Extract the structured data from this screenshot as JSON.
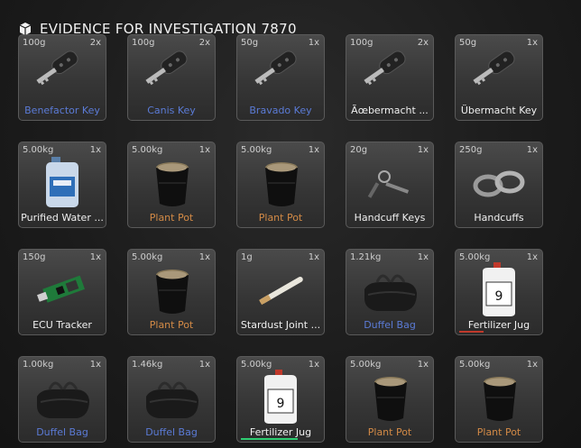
{
  "header": {
    "title": "EVIDENCE FOR INVESTIGATION 7870",
    "icon": "box-icon"
  },
  "slots": [
    {
      "weight": "100g",
      "qty": "2x",
      "name": "Benefactor Key",
      "rarity": "blue",
      "art": "key"
    },
    {
      "weight": "100g",
      "qty": "2x",
      "name": "Canis Key",
      "rarity": "blue",
      "art": "key"
    },
    {
      "weight": "50g",
      "qty": "1x",
      "name": "Bravado Key",
      "rarity": "blue",
      "art": "key"
    },
    {
      "weight": "100g",
      "qty": "2x",
      "name": "Ãœbermacht ...",
      "rarity": "white",
      "art": "key"
    },
    {
      "weight": "50g",
      "qty": "1x",
      "name": "Übermacht Key",
      "rarity": "white",
      "art": "key"
    },
    {
      "weight": "5.00kg",
      "qty": "1x",
      "name": "Purified Water ...",
      "rarity": "white",
      "art": "water"
    },
    {
      "weight": "5.00kg",
      "qty": "1x",
      "name": "Plant Pot",
      "rarity": "orange",
      "art": "pot"
    },
    {
      "weight": "5.00kg",
      "qty": "1x",
      "name": "Plant Pot",
      "rarity": "orange",
      "art": "pot"
    },
    {
      "weight": "20g",
      "qty": "1x",
      "name": "Handcuff Keys",
      "rarity": "white",
      "art": "cuffkeys"
    },
    {
      "weight": "250g",
      "qty": "1x",
      "name": "Handcuffs",
      "rarity": "white",
      "art": "cuffs"
    },
    {
      "weight": "150g",
      "qty": "1x",
      "name": "ECU Tracker",
      "rarity": "white",
      "art": "ecu"
    },
    {
      "weight": "5.00kg",
      "qty": "1x",
      "name": "Plant Pot",
      "rarity": "orange",
      "art": "pot"
    },
    {
      "weight": "1g",
      "qty": "1x",
      "name": "Stardust Joint ...",
      "rarity": "white",
      "art": "joint"
    },
    {
      "weight": "1.21kg",
      "qty": "1x",
      "name": "Duffel Bag",
      "rarity": "blue",
      "art": "bag"
    },
    {
      "weight": "5.00kg",
      "qty": "1x",
      "name": "Fertilizer Jug",
      "rarity": "white",
      "art": "jug",
      "bar": 0.3
    },
    {
      "weight": "1.00kg",
      "qty": "1x",
      "name": "Duffel Bag",
      "rarity": "blue",
      "art": "bag"
    },
    {
      "weight": "1.46kg",
      "qty": "1x",
      "name": "Duffel Bag",
      "rarity": "blue",
      "art": "bag"
    },
    {
      "weight": "5.00kg",
      "qty": "1x",
      "name": "Fertilizer Jug",
      "rarity": "white",
      "art": "jug",
      "bar": 0.7,
      "barColor": "#2ecc71"
    },
    {
      "weight": "5.00kg",
      "qty": "1x",
      "name": "Plant Pot",
      "rarity": "orange",
      "art": "pot"
    },
    {
      "weight": "5.00kg",
      "qty": "1x",
      "name": "Plant Pot",
      "rarity": "orange",
      "art": "pot"
    }
  ]
}
